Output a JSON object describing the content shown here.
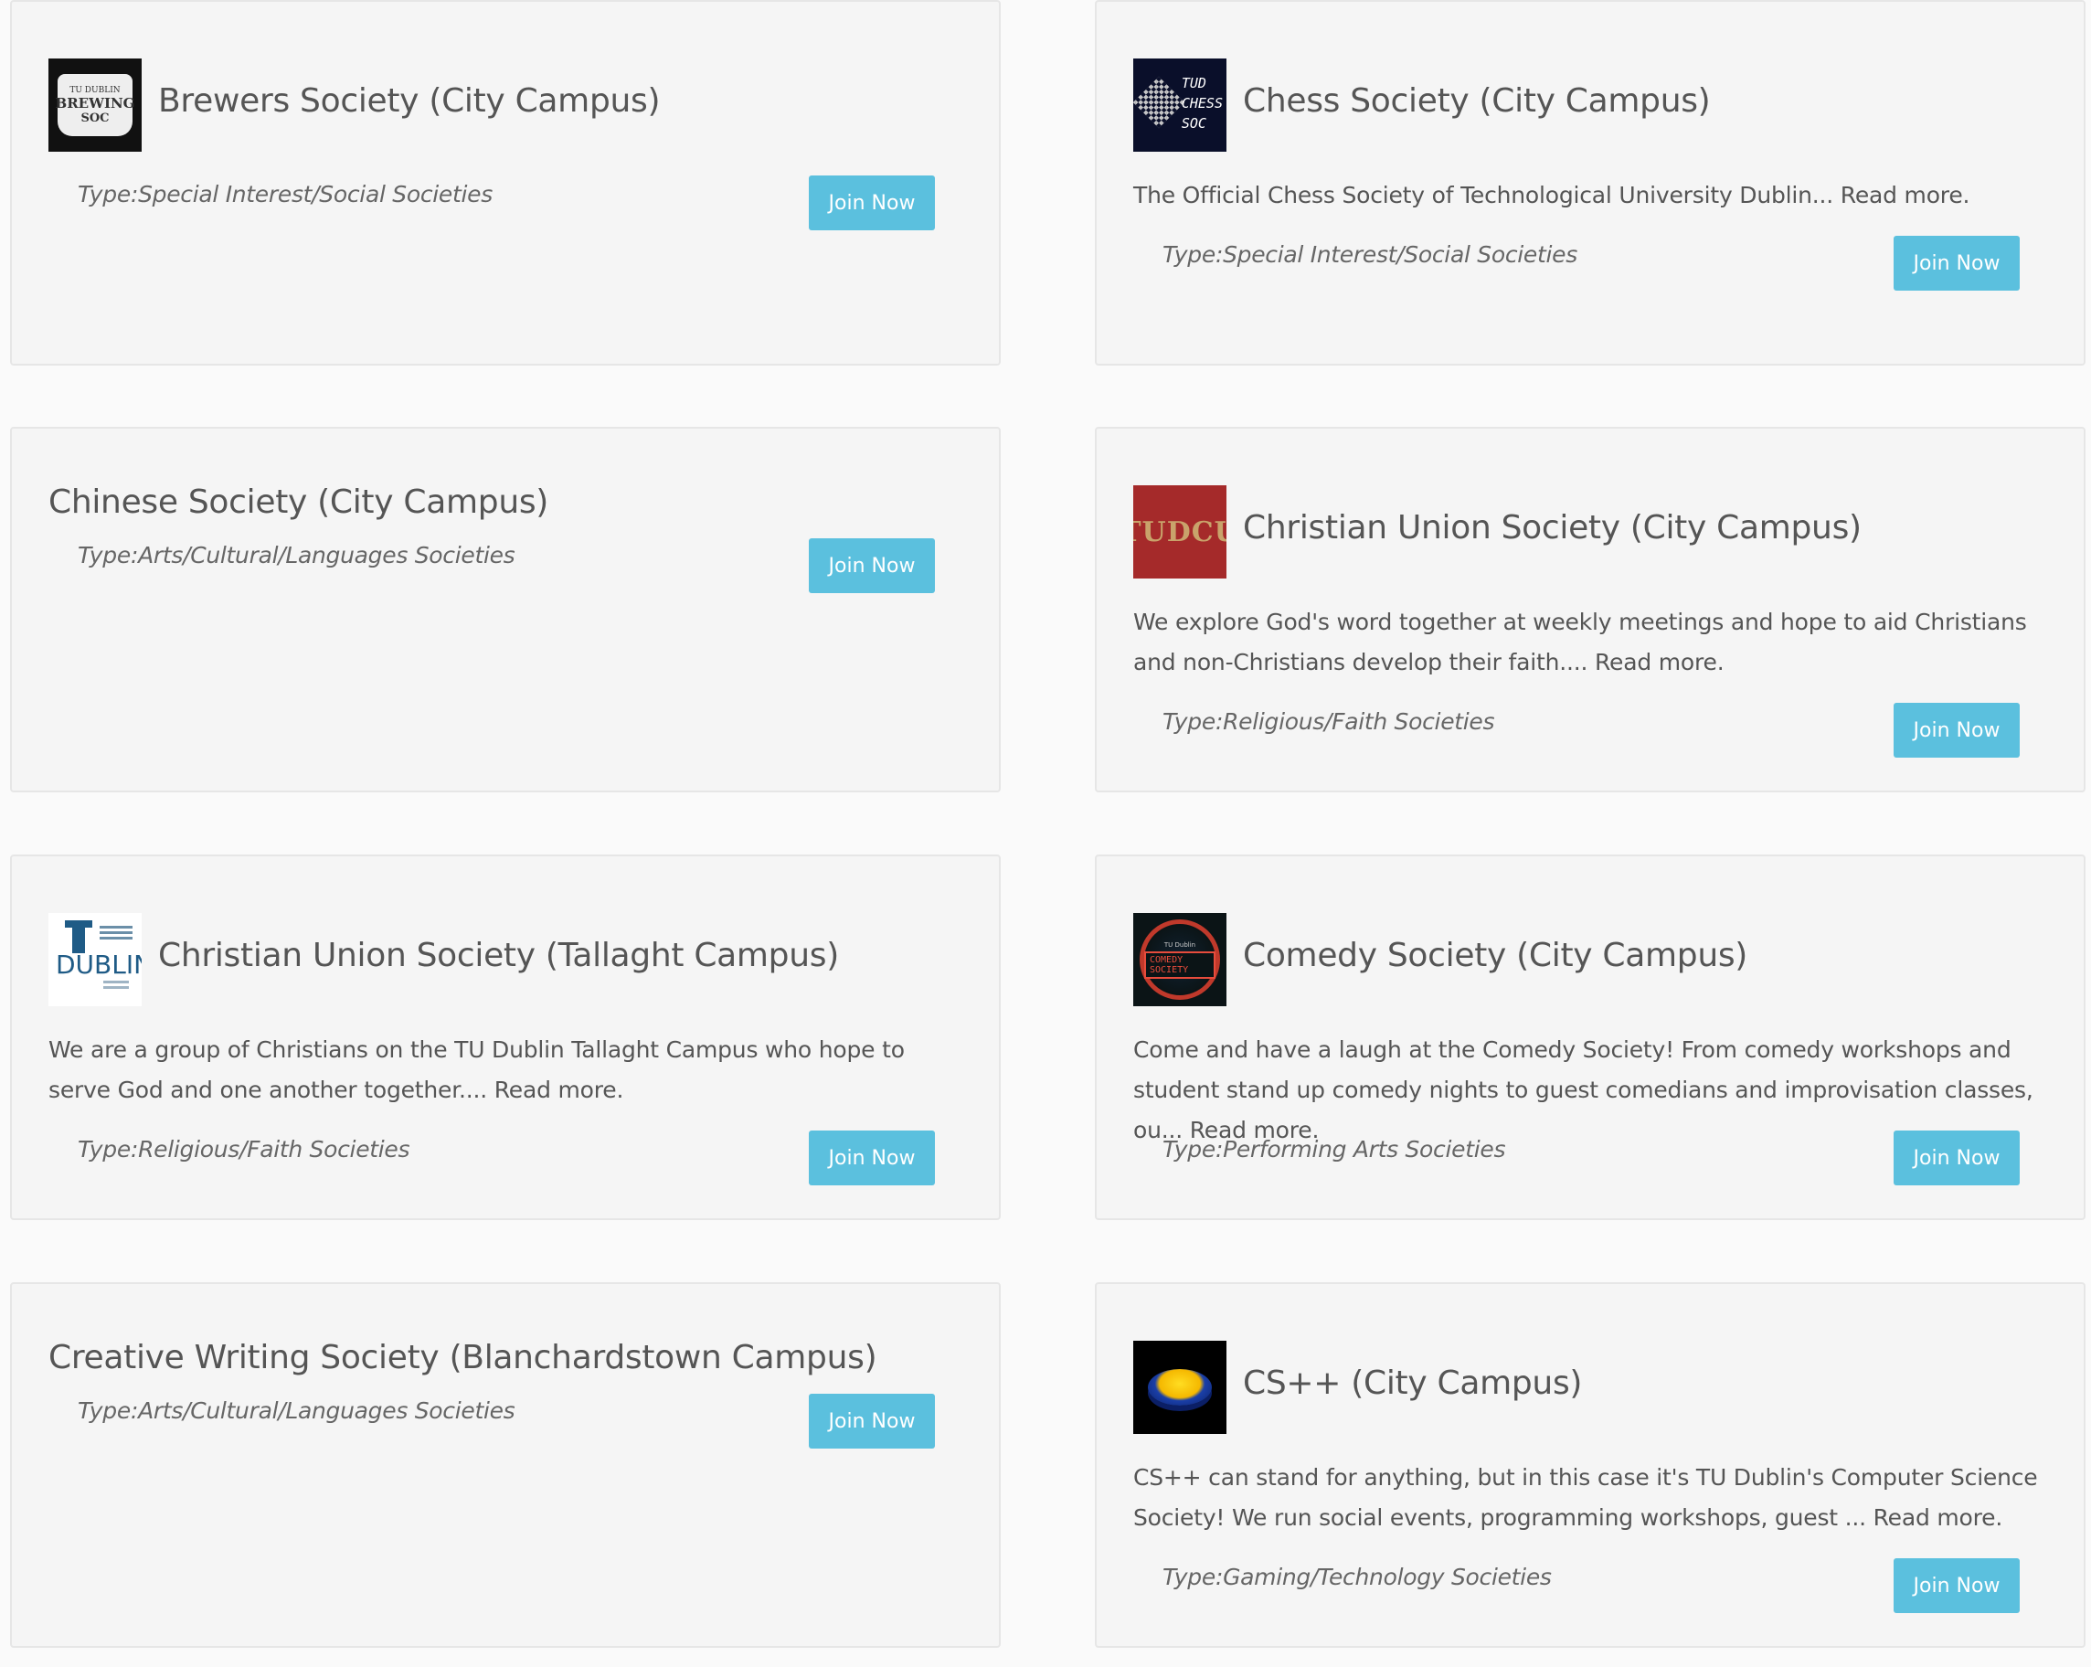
{
  "societies": [
    {
      "title": "Brewers Society (City Campus)",
      "logo": "brewing-soc-logo",
      "logo_text": [
        "TU DUBLIN",
        "BREWING",
        "SOC"
      ],
      "description": "",
      "read_more": "",
      "type": "Type:Special Interest/Social Societies",
      "join_label": "Join Now"
    },
    {
      "title": "Chess Society (City Campus)",
      "logo": "chess-soc-logo",
      "logo_text": [
        "TUD",
        "CHESS",
        "SOC"
      ],
      "description": "The Official Chess Society of Technological University Dublin...",
      "read_more": " Read more.",
      "type": "Type:Special Interest/Social Societies",
      "join_label": "Join Now"
    },
    {
      "title": "Chinese Society (City Campus)",
      "logo": "",
      "description": "",
      "read_more": "",
      "type": "Type:Arts/Cultural/Languages Societies",
      "join_label": "Join Now"
    },
    {
      "title": "Christian Union Society (City Campus)",
      "logo": "christian-union-city-logo",
      "logo_text": [
        "TUDCU"
      ],
      "description": "We explore God's word together at weekly meetings and hope to aid Christians and non-Christians develop their faith....",
      "read_more": " Read more.",
      "type": "Type:Religious/Faith Societies",
      "join_label": "Join Now"
    },
    {
      "title": "Christian Union Society (Tallaght Campus)",
      "logo": "tu-dublin-logo",
      "logo_text": [
        "DUBLIN"
      ],
      "description": "We are a group of Christians on the TU Dublin Tallaght Campus who hope to serve God and one another together....",
      "read_more": " Read more.",
      "type": "Type:Religious/Faith Societies",
      "join_label": "Join Now"
    },
    {
      "title": "Comedy Society (City Campus)",
      "logo": "comedy-society-logo",
      "logo_text": [
        "TU Dublin",
        "COMEDY SOCIETY"
      ],
      "description": "Come and have a laugh at the Comedy Society! From comedy workshops and student stand up comedy nights to guest comedians and improvisation classes, ou...",
      "read_more": " Read more.",
      "type": "Type:Performing Arts Societies",
      "join_label": "Join Now"
    },
    {
      "title": "Creative Writing Society (Blanchardstown Campus)",
      "logo": "",
      "description": "",
      "read_more": "",
      "type": "Type:Arts/Cultural/Languages Societies",
      "join_label": "Join Now"
    },
    {
      "title": "CS++ (City Campus)",
      "logo": "cspp-logo",
      "description": "CS++ can stand for anything, but in this case it's TU Dublin's Computer Science Society! We run social events, programming workshops, guest ...",
      "read_more": " Read more.",
      "type": "Type:Gaming/Technology Societies",
      "join_label": "Join Now"
    }
  ]
}
